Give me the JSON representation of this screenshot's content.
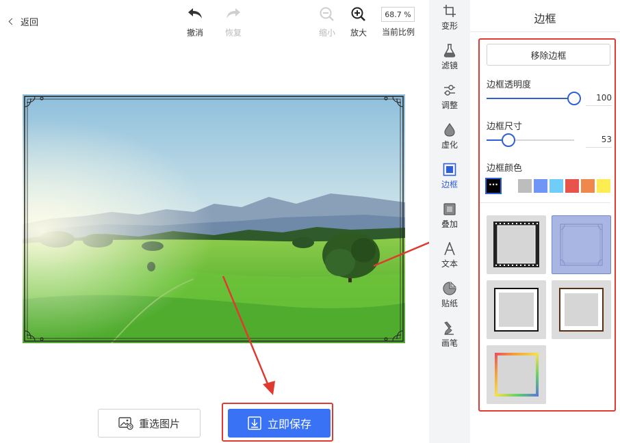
{
  "header": {
    "back_label": "返回",
    "undo_label": "撤消",
    "redo_label": "恢复",
    "zoom_out_label": "缩小",
    "zoom_in_label": "放大",
    "zoom_value": "68.7 %",
    "zoom_caption": "当前比例"
  },
  "actions": {
    "reselect_label": "重选图片",
    "save_label": "立即保存"
  },
  "tool_strip": {
    "items": [
      {
        "label": "变形",
        "icon": "crop-icon"
      },
      {
        "label": "滤镜",
        "icon": "flask-icon"
      },
      {
        "label": "调整",
        "icon": "sliders-icon"
      },
      {
        "label": "虚化",
        "icon": "droplet-icon"
      },
      {
        "label": "边框",
        "icon": "frame-icon",
        "active": true
      },
      {
        "label": "叠加",
        "icon": "overlay-icon"
      },
      {
        "label": "文本",
        "icon": "text-icon"
      },
      {
        "label": "贴纸",
        "icon": "sticker-icon"
      },
      {
        "label": "画笔",
        "icon": "brush-icon"
      }
    ]
  },
  "border_panel": {
    "title": "边框",
    "remove_label": "移除边框",
    "opacity_label": "边框透明度",
    "opacity_value": "100",
    "opacity_fraction": 1.0,
    "size_label": "边框尺寸",
    "size_value": "53",
    "size_fraction": 0.25,
    "color_label": "边框颜色",
    "colors": [
      "#000000",
      "#ffffff",
      "#bdbdbd",
      "#6f95f7",
      "#6fcdf7",
      "#e8544b",
      "#f0874d",
      "#fbed52"
    ],
    "selected_color_index": 0,
    "frames": [
      "film-strip-frame",
      "ornate-frame",
      "black-frame",
      "brown-frame",
      "rainbow-frame"
    ],
    "selected_frame_index": 1
  },
  "colors": {
    "accent": "#3a72f5",
    "annotation_red": "#e03a30"
  }
}
